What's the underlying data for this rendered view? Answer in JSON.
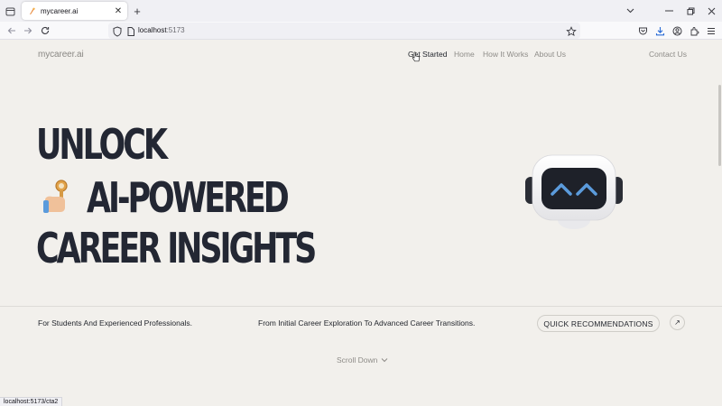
{
  "browser": {
    "tab_title": "mycareer.ai",
    "url_host": "localhost",
    "url_port": ":5173",
    "status_url": "localhost:5173/cta2"
  },
  "site": {
    "logo": "mycareer.ai",
    "nav": [
      {
        "label": "Get Started",
        "active": true
      },
      {
        "label": "Home",
        "active": false
      },
      {
        "label": "How It Works",
        "active": false
      },
      {
        "label": "About Us",
        "active": false
      }
    ],
    "contact": "Contact Us"
  },
  "hero": {
    "line1": "UNLOCK",
    "line2": "AI-POWERED",
    "line3": "CAREER INSIGHTS"
  },
  "info": {
    "left": "For Students And Experienced Professionals.",
    "middle": "From Initial Career Exploration To Advanced Career Transitions.",
    "button": "QUICK RECOMMENDATIONS",
    "arrow": "↗"
  },
  "scroll_down": "Scroll Down",
  "colors": {
    "background": "#f2f0ec",
    "heading": "#232733",
    "muted": "#8e8c88",
    "robot_eyes": "#5b9bdc"
  }
}
